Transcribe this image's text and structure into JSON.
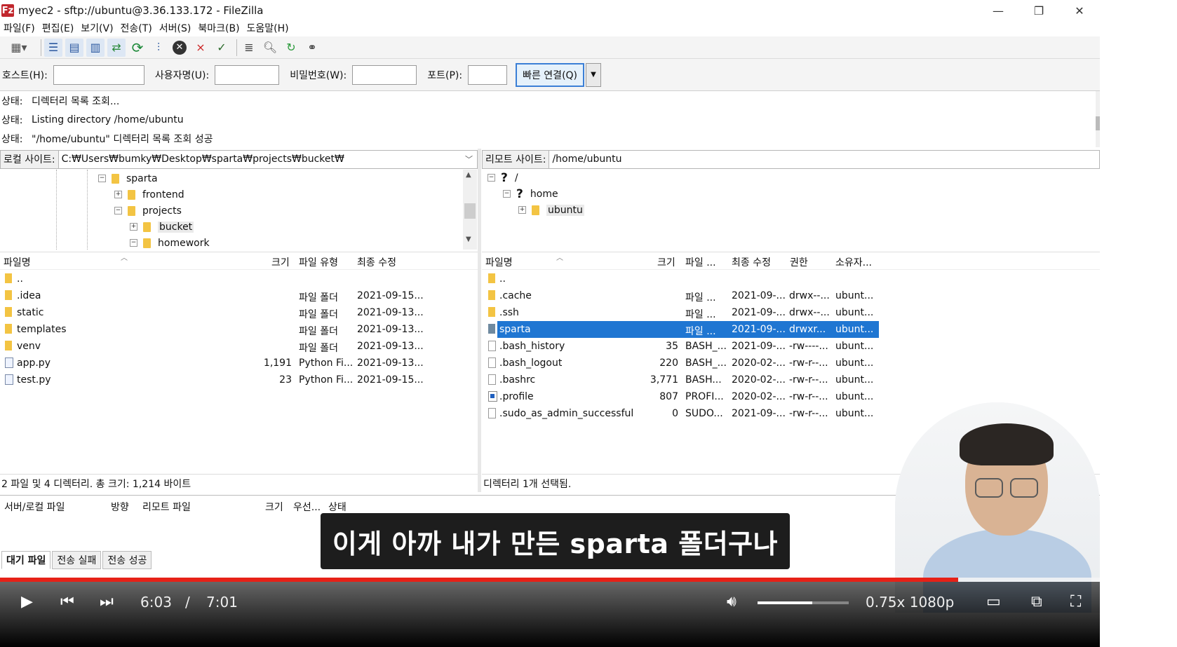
{
  "window": {
    "app_icon": "Fz",
    "title": "myec2 - sftp://ubuntu@3.36.133.172 - FileZilla",
    "minimize": "—",
    "restore": "❐",
    "close": "✕"
  },
  "menu": [
    "파일(F)",
    "편집(E)",
    "보기(V)",
    "전송(T)",
    "서버(S)",
    "북마크(B)",
    "도움말(H)"
  ],
  "toolbar_icons": [
    "site-manager-icon",
    "toggle-log-icon",
    "toggle-local-tree-icon",
    "toggle-remote-tree-icon",
    "toggle-queue-icon",
    "refresh-icon",
    "process-queue-icon",
    "cancel-icon",
    "disconnect-icon",
    "reconnect-icon",
    "directory-filter-icon",
    "search-icon",
    "sync-browse-icon",
    "find-files-icon"
  ],
  "quickconnect": {
    "host_label": "호스트(H):",
    "user_label": "사용자명(U):",
    "pass_label": "비밀번호(W):",
    "port_label": "포트(P):",
    "connect_label": "빠른 연결(Q)",
    "host_value": "",
    "user_value": "",
    "pass_value": "",
    "port_value": ""
  },
  "log": [
    {
      "label": "상태:",
      "text": "디렉터리 목록 조회..."
    },
    {
      "label": "상태:",
      "text": "Listing directory /home/ubuntu"
    },
    {
      "label": "상태:",
      "text": "\"/home/ubuntu\" 디렉터리 목록 조회 성공"
    }
  ],
  "local": {
    "site_label": "로컬 사이트:",
    "path": "C:₩Users₩bumky₩Desktop₩sparta₩projects₩bucket₩",
    "tree": [
      {
        "label": "sparta",
        "expander": "−"
      },
      {
        "label": "frontend",
        "expander": "+"
      },
      {
        "label": "projects",
        "expander": "−"
      },
      {
        "label": "bucket",
        "expander": "+"
      },
      {
        "label": "homework",
        "expander": "−"
      }
    ],
    "columns": {
      "name": "파일명",
      "size": "크기",
      "type": "파일 유형",
      "modified": "최종 수정"
    },
    "files": [
      {
        "name": "..",
        "size": "",
        "type": "",
        "modified": "",
        "icon": "folder"
      },
      {
        "name": ".idea",
        "size": "",
        "type": "파일 폴더",
        "modified": "2021-09-15...",
        "icon": "folder"
      },
      {
        "name": "static",
        "size": "",
        "type": "파일 폴더",
        "modified": "2021-09-13...",
        "icon": "folder"
      },
      {
        "name": "templates",
        "size": "",
        "type": "파일 폴더",
        "modified": "2021-09-13...",
        "icon": "folder"
      },
      {
        "name": "venv",
        "size": "",
        "type": "파일 폴더",
        "modified": "2021-09-13...",
        "icon": "folder"
      },
      {
        "name": "app.py",
        "size": "1,191",
        "type": "Python Fi...",
        "modified": "2021-09-13...",
        "icon": "py"
      },
      {
        "name": "test.py",
        "size": "23",
        "type": "Python Fi...",
        "modified": "2021-09-15...",
        "icon": "py"
      }
    ],
    "status": "2 파일 및 4 디렉터리. 총 크기: 1,214 바이트"
  },
  "remote": {
    "site_label": "리모트 사이트:",
    "path": "/home/ubuntu",
    "tree": [
      {
        "label": "/",
        "expander": "−",
        "icon": "question"
      },
      {
        "label": "home",
        "expander": "−",
        "icon": "question"
      },
      {
        "label": "ubuntu",
        "expander": "+",
        "icon": "folder"
      }
    ],
    "columns": {
      "name": "파일명",
      "size": "크기",
      "type": "파일 ...",
      "modified": "최종 수정",
      "perm": "권한",
      "owner": "소유자..."
    },
    "files": [
      {
        "name": "..",
        "size": "",
        "type": "",
        "modified": "",
        "perm": "",
        "owner": "",
        "icon": "folder"
      },
      {
        "name": ".cache",
        "size": "",
        "type": "파일 ...",
        "modified": "2021-09-...",
        "perm": "drwx--...",
        "owner": "ubunt...",
        "icon": "folder"
      },
      {
        "name": ".ssh",
        "size": "",
        "type": "파일 ...",
        "modified": "2021-09-...",
        "perm": "drwx--...",
        "owner": "ubunt...",
        "icon": "folder"
      },
      {
        "name": "sparta",
        "size": "",
        "type": "파일 ...",
        "modified": "2021-09-...",
        "perm": "drwxr...",
        "owner": "ubunt...",
        "icon": "folder"
      },
      {
        "name": ".bash_history",
        "size": "35",
        "type": "BASH_...",
        "modified": "2021-09-...",
        "perm": "-rw----...",
        "owner": "ubunt...",
        "icon": "file"
      },
      {
        "name": ".bash_logout",
        "size": "220",
        "type": "BASH_...",
        "modified": "2020-02-...",
        "perm": "-rw-r--...",
        "owner": "ubunt...",
        "icon": "file"
      },
      {
        "name": ".bashrc",
        "size": "3,771",
        "type": "BASH...",
        "modified": "2020-02-...",
        "perm": "-rw-r--...",
        "owner": "ubunt...",
        "icon": "file"
      },
      {
        "name": ".profile",
        "size": "807",
        "type": "PROFI...",
        "modified": "2020-02-...",
        "perm": "-rw-r--...",
        "owner": "ubunt...",
        "icon": "profile"
      },
      {
        "name": ".sudo_as_admin_successful",
        "size": "0",
        "type": "SUDO...",
        "modified": "2021-09-...",
        "perm": "-rw-r--...",
        "owner": "ubunt...",
        "icon": "file"
      }
    ],
    "selected_index": 3,
    "status": "디렉터리 1개 선택됨."
  },
  "queue": {
    "columns": {
      "file": "서버/로컬 파일",
      "direction": "방향",
      "remote": "리모트 파일",
      "size": "크기",
      "priority": "우선...",
      "status": "상태"
    },
    "tabs": [
      "대기 파일",
      "전송 실패",
      "전송 성공"
    ]
  },
  "subtitle": "이게 아까 내가 만든 sparta 폴더구나",
  "player": {
    "current_time": "6:03",
    "separator": "/",
    "duration": "7:01",
    "quality": "0.75x 1080p",
    "progress": 0.871,
    "buffered_end": 1.0,
    "volume": 0.6,
    "accent": "#e62117"
  }
}
